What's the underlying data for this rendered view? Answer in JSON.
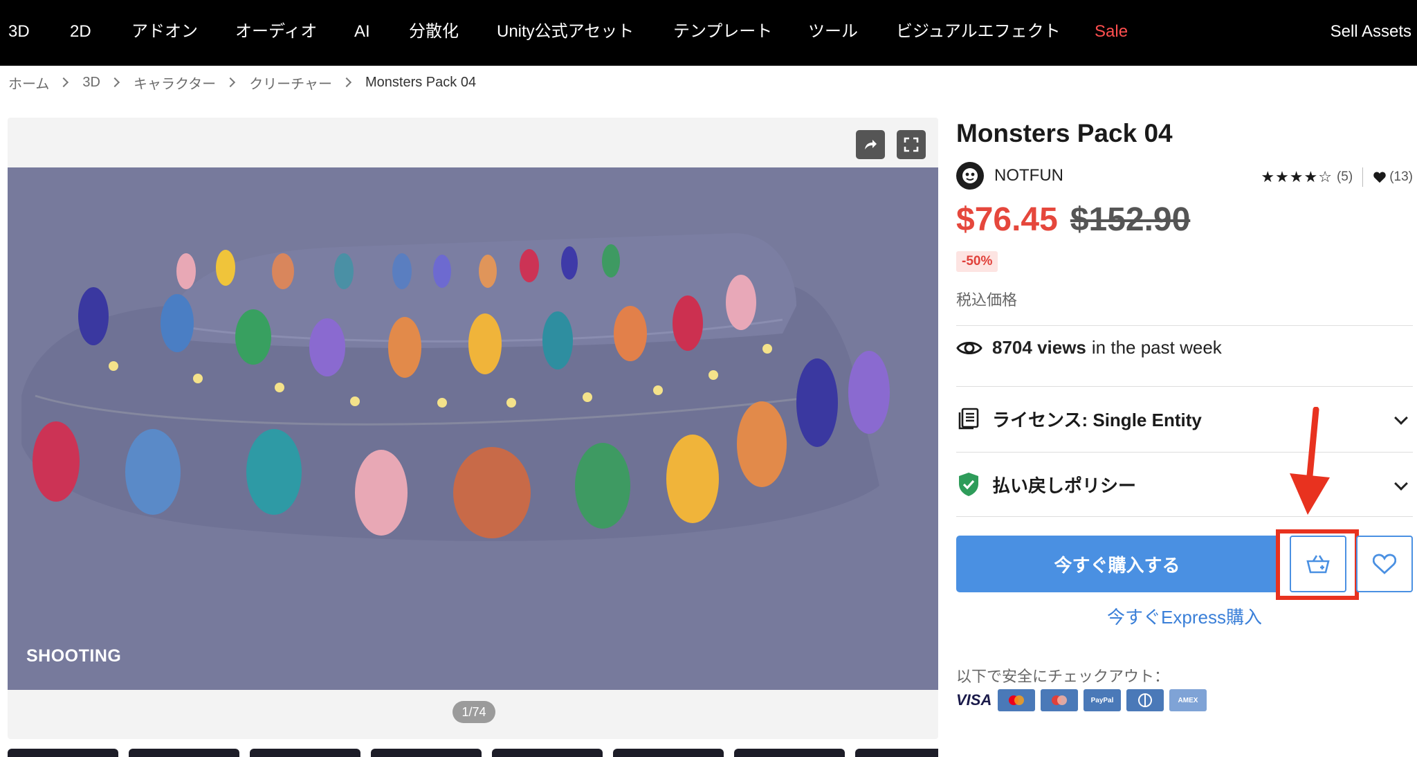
{
  "nav": {
    "items": [
      "3D",
      "2D",
      "アドオン",
      "オーディオ",
      "AI",
      "分散化",
      "Unity公式アセット",
      "テンプレート",
      "ツール",
      "ビジュアルエフェクト",
      "Sale"
    ],
    "sell": "Sell Assets"
  },
  "breadcrumb": [
    "ホーム",
    "3D",
    "キャラクター",
    "クリーチャー",
    "Monsters Pack 04"
  ],
  "gallery": {
    "caption": "SHOOTING",
    "counter": "1/74"
  },
  "product": {
    "title": "Monsters Pack 04",
    "seller": "NOTFUN",
    "rating_stars": "★★★★☆",
    "rating_value": 4,
    "rating_count": "(5)",
    "favorites": "(13)",
    "price": "$76.45",
    "original_price": "$152.90",
    "discount": "-50%",
    "tax_label": "税込価格",
    "views_count": "8704 views",
    "views_suffix": "in the past week",
    "license_label": "ライセンス: Single Entity",
    "refund_label": "払い戻しポリシー",
    "buy_label": "今すぐ購入する",
    "express_label": "今すぐExpress購入",
    "checkout_label": "以下で安全にチェックアウト：",
    "payment_methods": [
      "VISA",
      "Mastercard",
      "Maestro",
      "PayPal",
      "Diners",
      "AMEX"
    ],
    "payment_card_texts": [
      "",
      "",
      "PayPal",
      "",
      "AMEX"
    ]
  },
  "colors": {
    "nav_bg": "#000000",
    "sale": "#ff4f4f",
    "price": "#e5473c",
    "accent_blue": "#4a90e2",
    "highlight_red": "#e8321f",
    "shield_green": "#2e9c5a"
  },
  "icons": {
    "share": "share-icon",
    "fullscreen": "fullscreen-icon",
    "eye": "eye-icon",
    "license": "document-icon",
    "refund": "shield-check-icon",
    "cart": "cart-add-icon",
    "wishlist": "heart-icon"
  }
}
